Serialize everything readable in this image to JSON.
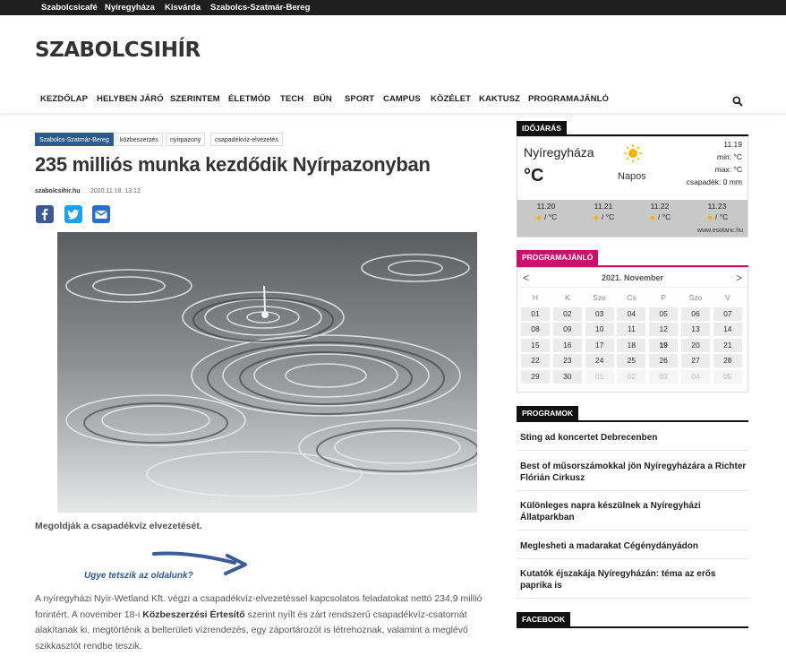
{
  "topbar": {
    "links": [
      "Szabolcsicafé",
      "Nyíregyháza",
      "Kisvárda",
      "Szabolcs-Szatmár-Bereg"
    ]
  },
  "logo": {
    "text": "SZABOLCSIHÍR"
  },
  "nav": {
    "items": [
      "KEZDŐLAP",
      "HELYBEN JÁRÓ",
      "SZERINTEM",
      "ÉLETMÓD",
      "TECH",
      "BŰN",
      "SPORT",
      "CAMPUS",
      "KÖZÉLET",
      "KAKTUSZ",
      "PROGRAMAJÁNLÓ"
    ]
  },
  "article": {
    "tags": [
      "Szabolcs-Szatmár-Bereg",
      "közbeszerzés",
      "nyírpazony",
      "csapadékvíz-elvezetés"
    ],
    "title": "235 milliós munka kezdődik Nyírpazonyban",
    "author": "szabolcsihir.hu",
    "date": "2020.11.18. 13:12",
    "caption": "Megoldják a csapadékvíz elvezetését.",
    "promo": "Ugye tetszik az oldalunk?",
    "body_1": "A nyíregyházi Nyír-Wetland Kft. végzi a csapadékvíz-elvezetéssel kapcsolatos feladatokat nettó 234,9 millió forintért. A november 18-i ",
    "body_bold": "Közbeszerzési Értesítő",
    "body_2": " szerint nyílt és zárt rendszerű csapadékvíz-csatornát alakítanak ki, megtörténik a belterületi vízrendezés, egy záportározót is létrehoznak, valamint a meglévő szikkasztót rendbe teszik."
  },
  "weather": {
    "label": "IDŐJÁRÁS",
    "city": "Nyíregyháza",
    "temp": "°C",
    "condition": "Napos",
    "date": "11.19",
    "min": "min: °C",
    "max": "max: °C",
    "rain": "csapadék: 0 mm",
    "forecast": [
      {
        "date": "11.20",
        "temp": "/ °C"
      },
      {
        "date": "11.21",
        "temp": "/ °C"
      },
      {
        "date": "11.22",
        "temp": "/ °C"
      },
      {
        "date": "11.23",
        "temp": "/ °C"
      }
    ],
    "source": "www.esotanc.hu",
    "colors": {
      "sun": "#f2b400"
    }
  },
  "calendar": {
    "label": "PROGRAMAJÁNLÓ",
    "month": "2021. November",
    "prev": "<",
    "next": ">",
    "weekdays": [
      "H",
      "K",
      "Sze",
      "Cs",
      "P",
      "Szo",
      "V"
    ],
    "weeks": [
      [
        "01",
        "02",
        "03",
        "04",
        "05",
        "06",
        "07"
      ],
      [
        "08",
        "09",
        "10",
        "11",
        "12",
        "13",
        "14"
      ],
      [
        "15",
        "16",
        "17",
        "18",
        "19",
        "20",
        "21"
      ],
      [
        "22",
        "23",
        "24",
        "25",
        "26",
        "27",
        "28"
      ],
      [
        "29",
        "30",
        "01",
        "02",
        "03",
        "04",
        "05"
      ]
    ],
    "today": "19"
  },
  "programs": {
    "label": "PROGRAMOK",
    "items": [
      "Sting ad koncertet Debrecenben",
      "Best of műsorszámokkal jön Nyíregyházára a Richter Flórián Cirkusz",
      "Különleges napra készülnek a Nyíregyházi Állatparkban",
      "Meglesheti a madarakat Cégénydányádon",
      "Kutatók éjszakája Nyíregyházán: téma az erős paprika is"
    ]
  },
  "facebook": {
    "label": "FACEBOOK"
  },
  "colors": {
    "accent": "#c8106e",
    "tag_primary": "#2a5a8f",
    "facebook": "#3b5998",
    "twitter": "#1da1f2",
    "email": "#2a6fc9"
  }
}
